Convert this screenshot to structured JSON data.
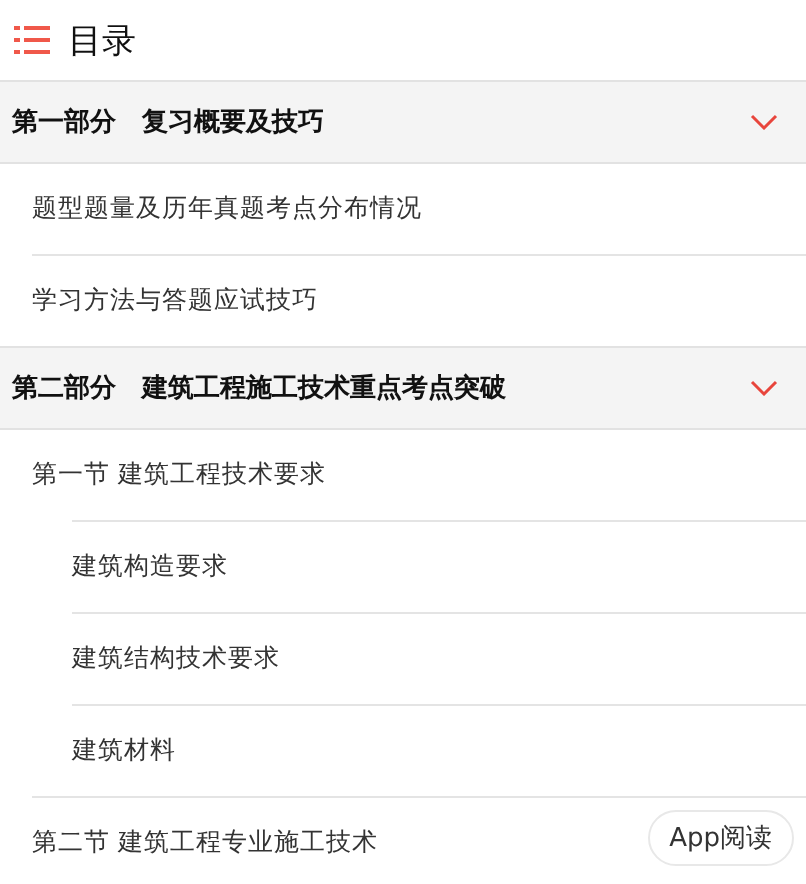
{
  "header": {
    "title": "目录"
  },
  "parts": [
    {
      "title": "第一部分　复习概要及技巧",
      "expanded": true,
      "items": [
        {
          "title": "题型题量及历年真题考点分布情况"
        },
        {
          "title": "学习方法与答题应试技巧"
        }
      ]
    },
    {
      "title": "第二部分　建筑工程施工技术重点考点突破",
      "expanded": true,
      "items": [
        {
          "title": "第一节 建筑工程技术要求",
          "children": [
            {
              "title": "建筑构造要求"
            },
            {
              "title": "建筑结构技术要求"
            },
            {
              "title": "建筑材料"
            }
          ]
        },
        {
          "title": "第二节 建筑工程专业施工技术"
        }
      ]
    }
  ],
  "app_button": {
    "label": "App阅读"
  }
}
